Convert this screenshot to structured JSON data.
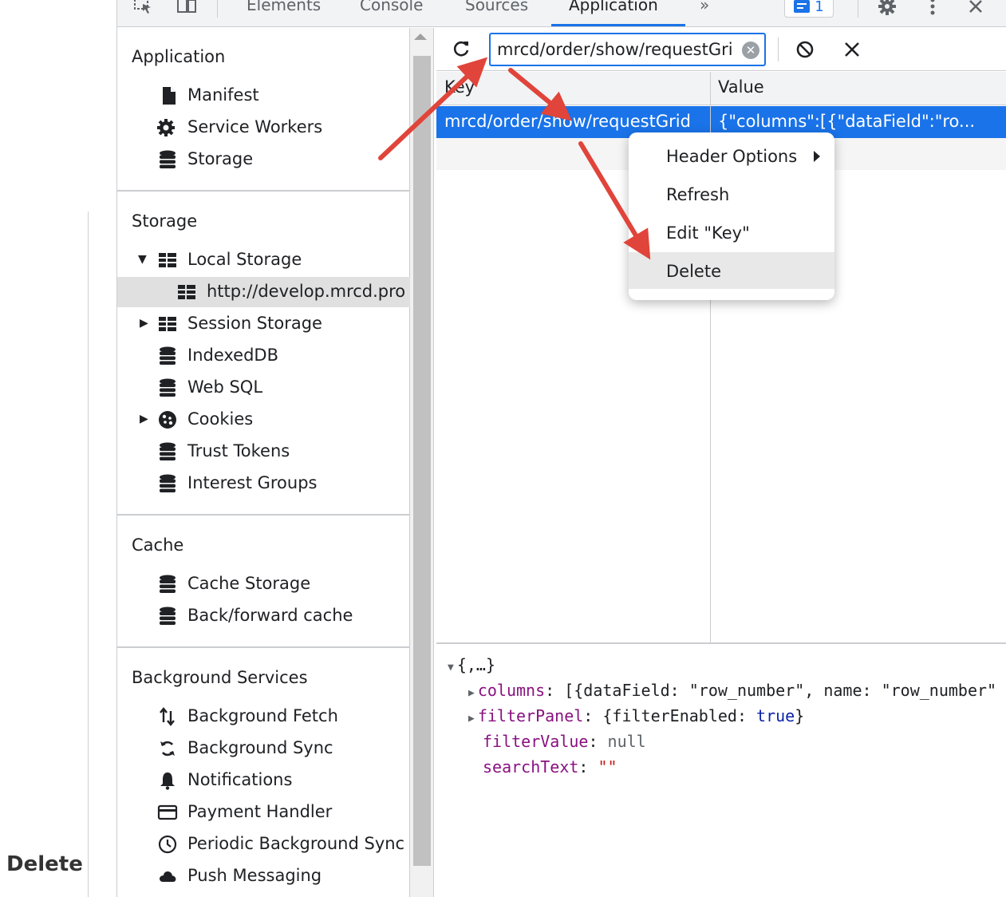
{
  "caption": "Delete",
  "toolbar": {
    "tabs": [
      {
        "label": "Elements"
      },
      {
        "label": "Console"
      },
      {
        "label": "Sources"
      },
      {
        "label": "Application"
      }
    ],
    "more_tabs": "»",
    "issues_count": "1"
  },
  "sidebar": {
    "sections": [
      {
        "title": "Application",
        "items": [
          {
            "label": "Manifest",
            "icon": "document-icon"
          },
          {
            "label": "Service Workers",
            "icon": "gear-icon"
          },
          {
            "label": "Storage",
            "icon": "database-icon"
          }
        ]
      },
      {
        "title": "Storage",
        "items": [
          {
            "label": "Local Storage",
            "icon": "grid-icon",
            "expanded": true
          },
          {
            "label": "http://develop.mrcd.pro",
            "icon": "grid-icon",
            "selected": true
          },
          {
            "label": "Session Storage",
            "icon": "grid-icon",
            "expanded": false
          },
          {
            "label": "IndexedDB",
            "icon": "database-icon"
          },
          {
            "label": "Web SQL",
            "icon": "database-icon"
          },
          {
            "label": "Cookies",
            "icon": "cookie-icon",
            "expanded": false
          },
          {
            "label": "Trust Tokens",
            "icon": "database-icon"
          },
          {
            "label": "Interest Groups",
            "icon": "database-icon"
          }
        ]
      },
      {
        "title": "Cache",
        "items": [
          {
            "label": "Cache Storage",
            "icon": "database-icon"
          },
          {
            "label": "Back/forward cache",
            "icon": "database-icon"
          }
        ]
      },
      {
        "title": "Background Services",
        "items": [
          {
            "label": "Background Fetch",
            "icon": "up-down-arrows-icon"
          },
          {
            "label": "Background Sync",
            "icon": "sync-icon"
          },
          {
            "label": "Notifications",
            "icon": "bell-icon"
          },
          {
            "label": "Payment Handler",
            "icon": "card-icon"
          },
          {
            "label": "Periodic Background Sync",
            "icon": "clock-icon"
          },
          {
            "label": "Push Messaging",
            "icon": "cloud-icon"
          }
        ]
      }
    ]
  },
  "storage": {
    "filter_value": "mrcd/order/show/requestGri",
    "columns": {
      "key": "Key",
      "value": "Value"
    },
    "selected_row": {
      "key": "mrcd/order/show/requestGrid",
      "value": "{\"columns\":[{\"dataField\":\"ro..."
    }
  },
  "context_menu": {
    "items": [
      {
        "label": "Header Options",
        "has_submenu": true
      },
      {
        "label": "Refresh"
      },
      {
        "label": "Edit \"Key\""
      },
      {
        "label": "Delete",
        "highlighted": true
      }
    ]
  },
  "preview": {
    "root": "{,…}",
    "columns_key": "columns",
    "columns_val": "[{dataField: \"row_number\", name: \"row_number\"",
    "filterPanel_key": "filterPanel",
    "filterPanel_pre": "{filterEnabled: ",
    "filterPanel_bool": "true",
    "filterPanel_post": "}",
    "filterValue_key": "filterValue",
    "filterValue_val": "null",
    "searchText_key": "searchText",
    "searchText_val": "\"\""
  },
  "colors": {
    "accent": "#1a73e8",
    "annotation_arrow": "#e0443a"
  }
}
